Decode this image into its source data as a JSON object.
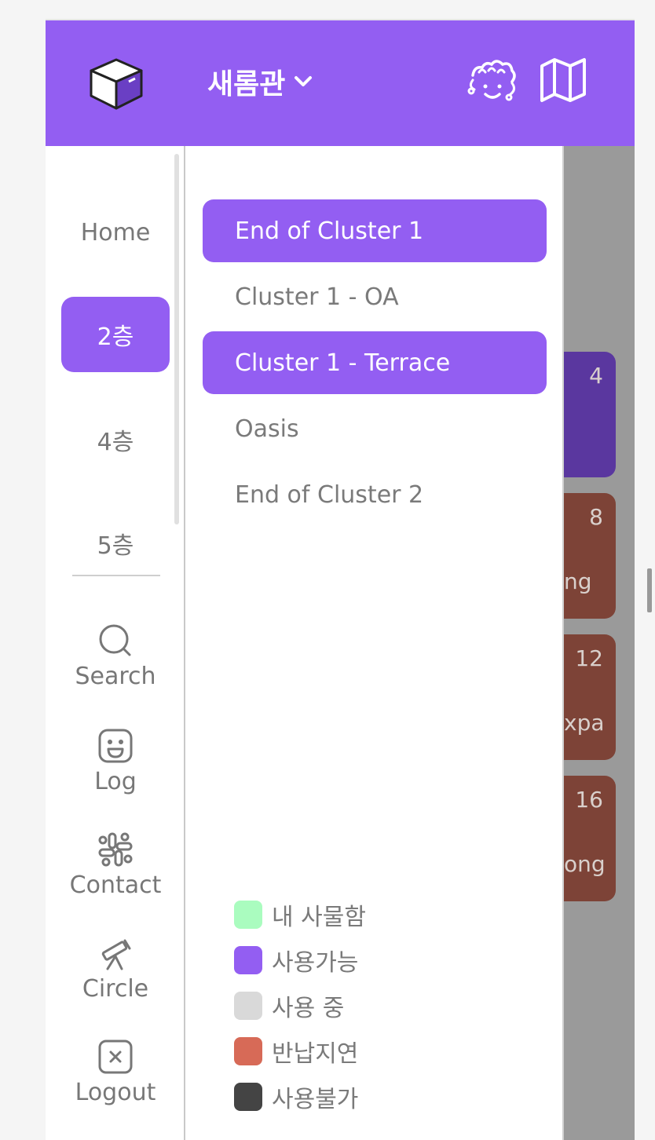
{
  "header": {
    "building": "새롬관",
    "bg_color": "#935ef2"
  },
  "icons": {
    "logo": "box-logo-icon",
    "chevron": "chevron-down-icon",
    "friends": "friends-icon",
    "map": "map-icon"
  },
  "rail": {
    "floors": [
      {
        "label": "Home",
        "active": false
      },
      {
        "label": "2층",
        "active": true
      },
      {
        "label": "4층",
        "active": false
      },
      {
        "label": "5층",
        "active": false
      }
    ],
    "actions": [
      {
        "label": "Search",
        "icon": "search-icon"
      },
      {
        "label": "Log",
        "icon": "smiley-icon"
      },
      {
        "label": "Contact",
        "icon": "slack-icon"
      },
      {
        "label": "Circle",
        "icon": "telescope-icon"
      },
      {
        "label": "Logout",
        "icon": "close-box-icon"
      }
    ]
  },
  "clusters": [
    {
      "label": "End of Cluster 1",
      "active": true
    },
    {
      "label": "Cluster 1 - OA",
      "active": false
    },
    {
      "label": "Cluster 1 - Terrace",
      "active": true
    },
    {
      "label": "Oasis",
      "active": false
    },
    {
      "label": "End of Cluster 2",
      "active": false
    }
  ],
  "legend": [
    {
      "label": "내 사물함",
      "color": "#aafcbf"
    },
    {
      "label": "사용가능",
      "color": "#935ef2"
    },
    {
      "label": "사용 중",
      "color": "#d9d9d9"
    },
    {
      "label": "반납지연",
      "color": "#d76a57"
    },
    {
      "label": "사용불가",
      "color": "#444444"
    }
  ],
  "lockers": [
    {
      "number": "4",
      "name": "",
      "color": "#5a379f"
    },
    {
      "number": "8",
      "name": "ng",
      "color": "#7d4337"
    },
    {
      "number": "12",
      "name": "xpa",
      "color": "#7d4337"
    },
    {
      "number": "16",
      "name": "ong",
      "color": "#7d4337"
    }
  ]
}
